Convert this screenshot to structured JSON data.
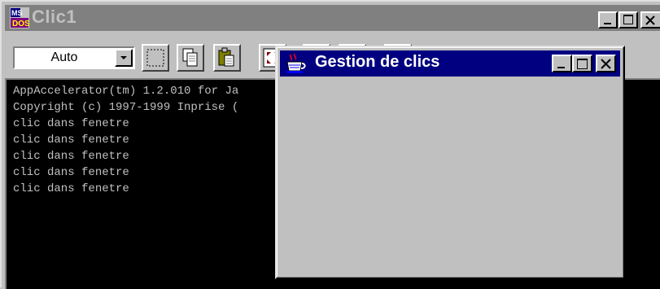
{
  "console": {
    "title": "Clic1",
    "app_icon": "ms-dos-icon",
    "buttons": [
      "minimize-icon",
      "maximize-icon",
      "close-icon"
    ],
    "toolbar": {
      "font_size_value": "Auto",
      "tools": [
        "mark-icon",
        "copy-icon",
        "paste-icon",
        "fullscreen-icon"
      ]
    },
    "lines": [
      "AppAccelerator(tm) 1.2.010 for Ja",
      "Copyright (c) 1997-1999 Inprise (",
      "clic dans fenetre",
      "clic dans fenetre",
      "clic dans fenetre",
      "clic dans fenetre",
      "clic dans fenetre"
    ]
  },
  "dialog": {
    "title": "Gestion de clics",
    "icon": "java-cup-icon",
    "buttons": [
      "minimize-icon",
      "maximize-icon",
      "close-icon"
    ],
    "active_title_color": "#000080"
  }
}
